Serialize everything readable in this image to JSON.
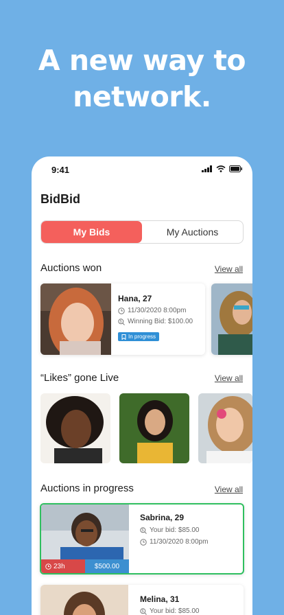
{
  "headline": {
    "line1": "A new way to",
    "line2": "network."
  },
  "status": {
    "time": "9:41"
  },
  "app": {
    "title": "BidBid"
  },
  "tabs": [
    {
      "label": "My Bids"
    },
    {
      "label": "My Auctions"
    }
  ],
  "sections": {
    "won": {
      "title": "Auctions won",
      "view_all": "View all"
    },
    "likes": {
      "title": "“Likes” gone Live",
      "view_all": "View all"
    },
    "progress": {
      "title": "Auctions in progress",
      "view_all": "View all"
    }
  },
  "won_card": {
    "name": "Hana, 27",
    "date": "11/30/2020 8:00pm",
    "winning_bid": "Winning Bid: $100.00",
    "badge": "In progress"
  },
  "progress_cards": [
    {
      "name": "Sabrina, 29",
      "your_bid": "Your bid: $85.00",
      "date": "11/30/2020 8:00pm",
      "time_left": "23h",
      "price": "$500.00"
    },
    {
      "name": "Melina, 31",
      "your_bid": "Your bid: $85.00"
    }
  ],
  "colors": {
    "background": "#6fb0e6",
    "accent": "#f4605c",
    "badge": "#2f8fd6",
    "highlight_border": "#2fbf5f"
  }
}
